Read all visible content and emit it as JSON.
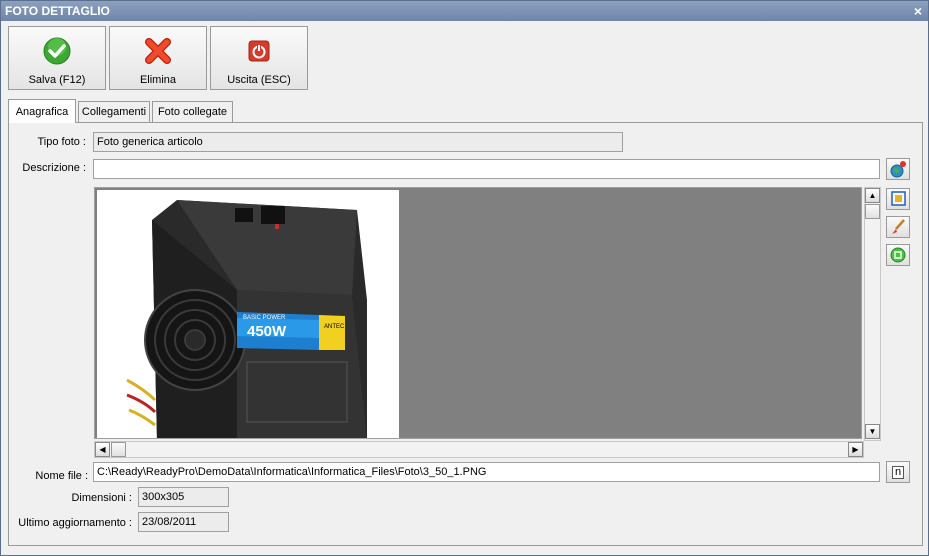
{
  "window": {
    "title": "FOTO DETTAGLIO",
    "close_glyph": "×"
  },
  "toolbar": {
    "save_label": "Salva (F12)",
    "delete_label": "Elimina",
    "exit_label": "Uscita (ESC)"
  },
  "tabs": [
    {
      "label": "Anagrafica"
    },
    {
      "label": "Collegamenti"
    },
    {
      "label": "Foto collegate"
    }
  ],
  "form": {
    "tipo_foto_label": "Tipo foto :",
    "tipo_foto_value": "Foto generica articolo",
    "descrizione_label": "Descrizione :",
    "descrizione_value": "",
    "nome_file_label": "Nome file :",
    "nome_file_value": "C:\\Ready\\ReadyPro\\DemoData\\Informatica\\Informatica_Files\\Foto\\3_50_1.PNG",
    "browse_label": "n",
    "dimensioni_label": "Dimensioni :",
    "dimensioni_value": "300x305",
    "ultimo_agg_label": "Ultimo aggiornamento :",
    "ultimo_agg_value": "23/08/2011"
  },
  "psu_image": {
    "brand_text": "BASIC POWER",
    "wattage_text": "450W",
    "side_text": "ANTEC"
  },
  "colors": {
    "save_green": "#3aa832",
    "delete_red": "#e8341c",
    "exit_red": "#d83a2a"
  }
}
